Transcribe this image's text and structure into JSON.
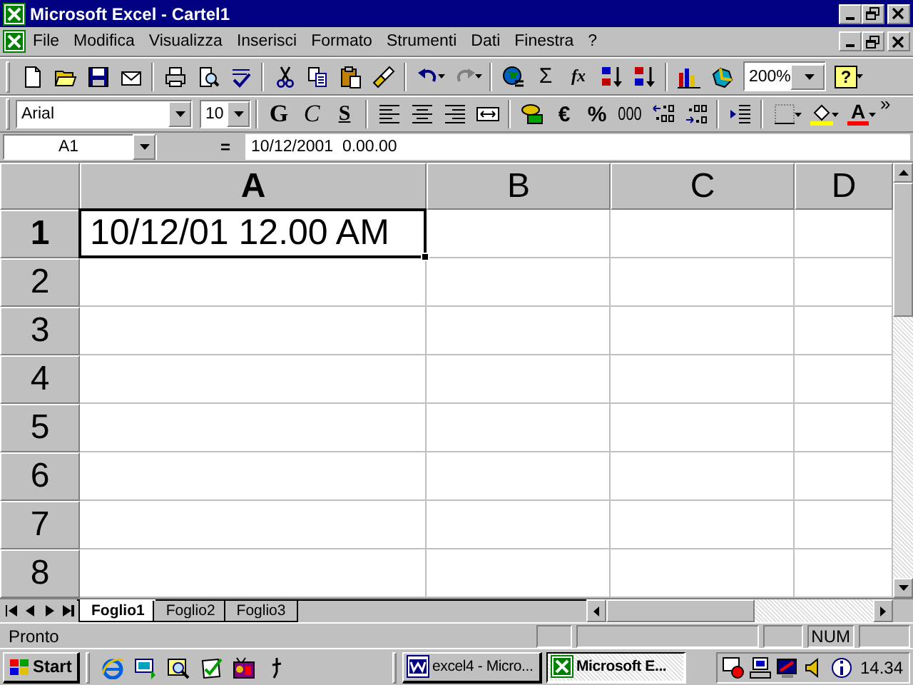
{
  "window": {
    "title": "Microsoft Excel - Cartel1"
  },
  "menu": [
    "File",
    "Modifica",
    "Visualizza",
    "Inserisci",
    "Formato",
    "Strumenti",
    "Dati",
    "Finestra",
    "?"
  ],
  "standard_toolbar": {
    "redo": {
      "disabled": true
    },
    "sum": "Σ",
    "function": "fx",
    "zoom": "200%",
    "help": "?"
  },
  "formatting_toolbar": {
    "font": "Arial",
    "size": "10",
    "bold": "G",
    "italic": "C",
    "underline": "S",
    "currency": "€",
    "percent": "%",
    "thousands": "000",
    "font_color": "A",
    "more": "»"
  },
  "formula_bar": {
    "name_box": "A1",
    "equals": "=",
    "content": "10/12/2001  0.00.00"
  },
  "sheet": {
    "columns": [
      {
        "label": "A",
        "selected": true
      },
      {
        "label": "B",
        "selected": false
      },
      {
        "label": "C",
        "selected": false
      },
      {
        "label": "D",
        "selected": false
      }
    ],
    "rows": [
      {
        "label": "1",
        "selected": true,
        "cells": [
          {
            "value": "10/12/01 12.00 AM",
            "selected": true
          }
        ]
      },
      {
        "label": "2",
        "selected": false
      },
      {
        "label": "3",
        "selected": false
      },
      {
        "label": "4",
        "selected": false
      },
      {
        "label": "5",
        "selected": false
      },
      {
        "label": "6",
        "selected": false
      },
      {
        "label": "7",
        "selected": false
      },
      {
        "label": "8",
        "selected": false
      }
    ]
  },
  "sheet_tabs": [
    {
      "label": "Foglio1",
      "selected": true
    },
    {
      "label": "Foglio2",
      "selected": false
    },
    {
      "label": "Foglio3",
      "selected": false
    }
  ],
  "status_bar": {
    "text": "Pronto",
    "indicators": [
      "NUM"
    ]
  },
  "taskbar": {
    "start": "Start",
    "tasks": [
      {
        "label": "excel4 - Micro...",
        "selected": false
      },
      {
        "label": "Microsoft E...",
        "selected": true
      }
    ],
    "clock": "14.34"
  }
}
